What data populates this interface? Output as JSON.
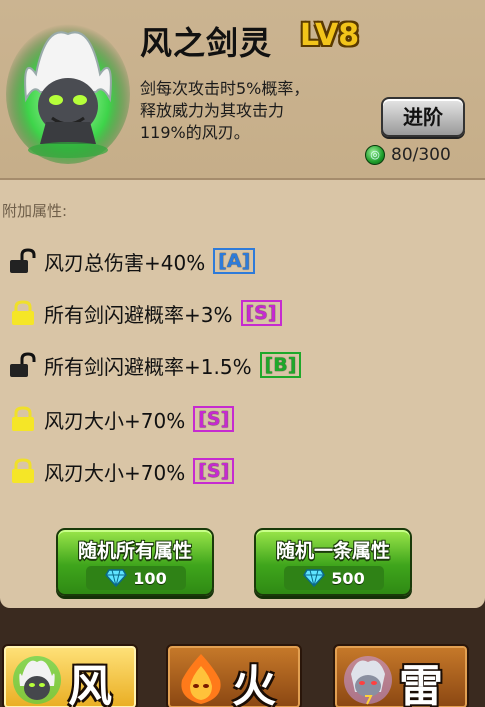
{
  "skill": {
    "name": "风之剑灵",
    "level": "LV8",
    "description_lines": [
      "剑每次攻击时5%概率，",
      "释放威力为其攻击力",
      "119%的风刃。"
    ],
    "advance_label": "进阶",
    "token_count": "80/300"
  },
  "attributes": {
    "heading": "附加属性:",
    "items": [
      {
        "text": "风刃总伤害+40%",
        "grade": "[A]",
        "locked": false
      },
      {
        "text": "所有剑闪避概率+3%",
        "grade": "[S]",
        "locked": true
      },
      {
        "text": "所有剑闪避概率+1.5%",
        "grade": "[B]",
        "locked": false
      },
      {
        "text": "风刃大小+70%",
        "grade": "[S]",
        "locked": true
      },
      {
        "text": "风刃大小+70%",
        "grade": "[S]",
        "locked": true
      }
    ]
  },
  "reroll": {
    "all": {
      "label": "随机所有属性",
      "cost": "100"
    },
    "one": {
      "label": "随机一条属性",
      "cost": "500"
    }
  },
  "tabs": [
    {
      "label": "风",
      "active": true,
      "icon": "wind-spirit-icon"
    },
    {
      "label": "火",
      "active": false,
      "icon": "fire-spirit-icon"
    },
    {
      "label": "雷",
      "active": false,
      "icon": "thunder-spirit-icon"
    }
  ],
  "colors": {
    "grade_A": "#2e7bd9",
    "grade_S": "#c62ad0",
    "grade_B": "#1ea82a",
    "level": "#f2c41a",
    "button_green": "#3fa51c"
  }
}
